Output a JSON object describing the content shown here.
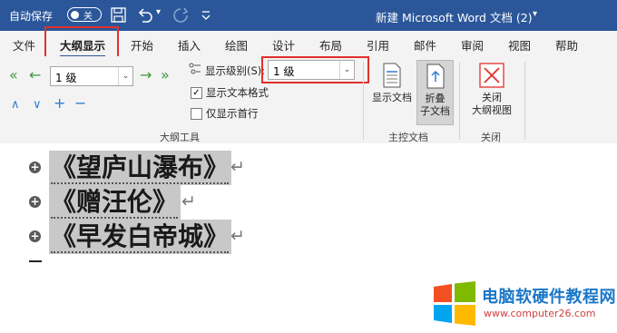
{
  "titlebar": {
    "autosave_label": "自动保存",
    "autosave_state": "关",
    "doc_title": "新建 Microsoft Word 文档 (2)",
    "title_chevron": "▾"
  },
  "tabs": [
    {
      "label": "文件"
    },
    {
      "label": "大纲显示"
    },
    {
      "label": "开始"
    },
    {
      "label": "插入"
    },
    {
      "label": "绘图"
    },
    {
      "label": "设计"
    },
    {
      "label": "布局"
    },
    {
      "label": "引用"
    },
    {
      "label": "邮件"
    },
    {
      "label": "审阅"
    },
    {
      "label": "视图"
    },
    {
      "label": "帮助"
    }
  ],
  "outline_tools": {
    "level_select_value": "1 级",
    "show_level_label": "显示级别(S):",
    "show_level_value": "1 级",
    "show_text_format_label": "显示文本格式",
    "show_text_format_checked": "✓",
    "show_first_line_label": "仅显示首行",
    "group_label": "大纲工具"
  },
  "master_document": {
    "show_document_label": "显示文档",
    "collapse_label_1": "折叠",
    "collapse_label_2": "子文档",
    "group_label": "主控文档"
  },
  "close_group": {
    "close_label_1": "关闭",
    "close_label_2": "大纲视图",
    "group_label": "关闭"
  },
  "document": {
    "headings": [
      {
        "text": "《望庐山瀑布》"
      },
      {
        "text": "《赠汪伦》"
      },
      {
        "text": "《早发白帝城》"
      }
    ],
    "return_mark": "↵"
  },
  "watermark": {
    "title": "电脑软硬件教程网",
    "url": "www.computer26.com"
  },
  "colors": {
    "titlebar": "#2b579a",
    "highlight": "#e2302b",
    "heading_shade": "#c8c8c8"
  }
}
